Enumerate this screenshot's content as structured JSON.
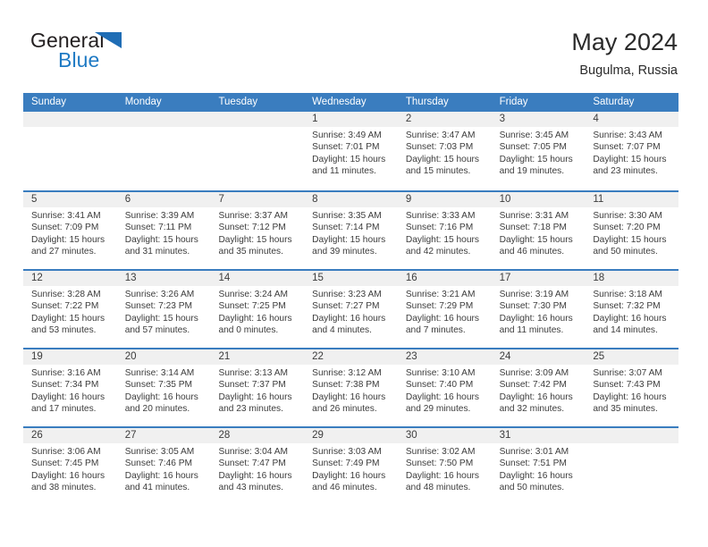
{
  "brand": {
    "name_top": "General",
    "name_bottom": "Blue",
    "flag_icon": "triangle-flag-icon",
    "accent_color": "#1f7ac4"
  },
  "header": {
    "title": "May 2024",
    "subtitle": "Bugulma, Russia"
  },
  "theme": {
    "header_blue": "#3a7dbf",
    "day_band_gray": "#f0f0f0",
    "text_color": "#3c3c3c"
  },
  "calendar": {
    "weekdays": [
      "Sunday",
      "Monday",
      "Tuesday",
      "Wednesday",
      "Thursday",
      "Friday",
      "Saturday"
    ],
    "labels": {
      "sunrise": "Sunrise:",
      "sunset": "Sunset:",
      "daylight": "Daylight:"
    },
    "weeks": [
      [
        {
          "day": "",
          "empty": true
        },
        {
          "day": "",
          "empty": true
        },
        {
          "day": "",
          "empty": true
        },
        {
          "day": "1",
          "sunrise": "Sunrise: 3:49 AM",
          "sunset": "Sunset: 7:01 PM",
          "daylight_1": "Daylight: 15 hours",
          "daylight_2": "and 11 minutes."
        },
        {
          "day": "2",
          "sunrise": "Sunrise: 3:47 AM",
          "sunset": "Sunset: 7:03 PM",
          "daylight_1": "Daylight: 15 hours",
          "daylight_2": "and 15 minutes."
        },
        {
          "day": "3",
          "sunrise": "Sunrise: 3:45 AM",
          "sunset": "Sunset: 7:05 PM",
          "daylight_1": "Daylight: 15 hours",
          "daylight_2": "and 19 minutes."
        },
        {
          "day": "4",
          "sunrise": "Sunrise: 3:43 AM",
          "sunset": "Sunset: 7:07 PM",
          "daylight_1": "Daylight: 15 hours",
          "daylight_2": "and 23 minutes."
        }
      ],
      [
        {
          "day": "5",
          "sunrise": "Sunrise: 3:41 AM",
          "sunset": "Sunset: 7:09 PM",
          "daylight_1": "Daylight: 15 hours",
          "daylight_2": "and 27 minutes."
        },
        {
          "day": "6",
          "sunrise": "Sunrise: 3:39 AM",
          "sunset": "Sunset: 7:11 PM",
          "daylight_1": "Daylight: 15 hours",
          "daylight_2": "and 31 minutes."
        },
        {
          "day": "7",
          "sunrise": "Sunrise: 3:37 AM",
          "sunset": "Sunset: 7:12 PM",
          "daylight_1": "Daylight: 15 hours",
          "daylight_2": "and 35 minutes."
        },
        {
          "day": "8",
          "sunrise": "Sunrise: 3:35 AM",
          "sunset": "Sunset: 7:14 PM",
          "daylight_1": "Daylight: 15 hours",
          "daylight_2": "and 39 minutes."
        },
        {
          "day": "9",
          "sunrise": "Sunrise: 3:33 AM",
          "sunset": "Sunset: 7:16 PM",
          "daylight_1": "Daylight: 15 hours",
          "daylight_2": "and 42 minutes."
        },
        {
          "day": "10",
          "sunrise": "Sunrise: 3:31 AM",
          "sunset": "Sunset: 7:18 PM",
          "daylight_1": "Daylight: 15 hours",
          "daylight_2": "and 46 minutes."
        },
        {
          "day": "11",
          "sunrise": "Sunrise: 3:30 AM",
          "sunset": "Sunset: 7:20 PM",
          "daylight_1": "Daylight: 15 hours",
          "daylight_2": "and 50 minutes."
        }
      ],
      [
        {
          "day": "12",
          "sunrise": "Sunrise: 3:28 AM",
          "sunset": "Sunset: 7:22 PM",
          "daylight_1": "Daylight: 15 hours",
          "daylight_2": "and 53 minutes."
        },
        {
          "day": "13",
          "sunrise": "Sunrise: 3:26 AM",
          "sunset": "Sunset: 7:23 PM",
          "daylight_1": "Daylight: 15 hours",
          "daylight_2": "and 57 minutes."
        },
        {
          "day": "14",
          "sunrise": "Sunrise: 3:24 AM",
          "sunset": "Sunset: 7:25 PM",
          "daylight_1": "Daylight: 16 hours",
          "daylight_2": "and 0 minutes."
        },
        {
          "day": "15",
          "sunrise": "Sunrise: 3:23 AM",
          "sunset": "Sunset: 7:27 PM",
          "daylight_1": "Daylight: 16 hours",
          "daylight_2": "and 4 minutes."
        },
        {
          "day": "16",
          "sunrise": "Sunrise: 3:21 AM",
          "sunset": "Sunset: 7:29 PM",
          "daylight_1": "Daylight: 16 hours",
          "daylight_2": "and 7 minutes."
        },
        {
          "day": "17",
          "sunrise": "Sunrise: 3:19 AM",
          "sunset": "Sunset: 7:30 PM",
          "daylight_1": "Daylight: 16 hours",
          "daylight_2": "and 11 minutes."
        },
        {
          "day": "18",
          "sunrise": "Sunrise: 3:18 AM",
          "sunset": "Sunset: 7:32 PM",
          "daylight_1": "Daylight: 16 hours",
          "daylight_2": "and 14 minutes."
        }
      ],
      [
        {
          "day": "19",
          "sunrise": "Sunrise: 3:16 AM",
          "sunset": "Sunset: 7:34 PM",
          "daylight_1": "Daylight: 16 hours",
          "daylight_2": "and 17 minutes."
        },
        {
          "day": "20",
          "sunrise": "Sunrise: 3:14 AM",
          "sunset": "Sunset: 7:35 PM",
          "daylight_1": "Daylight: 16 hours",
          "daylight_2": "and 20 minutes."
        },
        {
          "day": "21",
          "sunrise": "Sunrise: 3:13 AM",
          "sunset": "Sunset: 7:37 PM",
          "daylight_1": "Daylight: 16 hours",
          "daylight_2": "and 23 minutes."
        },
        {
          "day": "22",
          "sunrise": "Sunrise: 3:12 AM",
          "sunset": "Sunset: 7:38 PM",
          "daylight_1": "Daylight: 16 hours",
          "daylight_2": "and 26 minutes."
        },
        {
          "day": "23",
          "sunrise": "Sunrise: 3:10 AM",
          "sunset": "Sunset: 7:40 PM",
          "daylight_1": "Daylight: 16 hours",
          "daylight_2": "and 29 minutes."
        },
        {
          "day": "24",
          "sunrise": "Sunrise: 3:09 AM",
          "sunset": "Sunset: 7:42 PM",
          "daylight_1": "Daylight: 16 hours",
          "daylight_2": "and 32 minutes."
        },
        {
          "day": "25",
          "sunrise": "Sunrise: 3:07 AM",
          "sunset": "Sunset: 7:43 PM",
          "daylight_1": "Daylight: 16 hours",
          "daylight_2": "and 35 minutes."
        }
      ],
      [
        {
          "day": "26",
          "sunrise": "Sunrise: 3:06 AM",
          "sunset": "Sunset: 7:45 PM",
          "daylight_1": "Daylight: 16 hours",
          "daylight_2": "and 38 minutes."
        },
        {
          "day": "27",
          "sunrise": "Sunrise: 3:05 AM",
          "sunset": "Sunset: 7:46 PM",
          "daylight_1": "Daylight: 16 hours",
          "daylight_2": "and 41 minutes."
        },
        {
          "day": "28",
          "sunrise": "Sunrise: 3:04 AM",
          "sunset": "Sunset: 7:47 PM",
          "daylight_1": "Daylight: 16 hours",
          "daylight_2": "and 43 minutes."
        },
        {
          "day": "29",
          "sunrise": "Sunrise: 3:03 AM",
          "sunset": "Sunset: 7:49 PM",
          "daylight_1": "Daylight: 16 hours",
          "daylight_2": "and 46 minutes."
        },
        {
          "day": "30",
          "sunrise": "Sunrise: 3:02 AM",
          "sunset": "Sunset: 7:50 PM",
          "daylight_1": "Daylight: 16 hours",
          "daylight_2": "and 48 minutes."
        },
        {
          "day": "31",
          "sunrise": "Sunrise: 3:01 AM",
          "sunset": "Sunset: 7:51 PM",
          "daylight_1": "Daylight: 16 hours",
          "daylight_2": "and 50 minutes."
        },
        {
          "day": "",
          "empty": true
        }
      ]
    ]
  }
}
